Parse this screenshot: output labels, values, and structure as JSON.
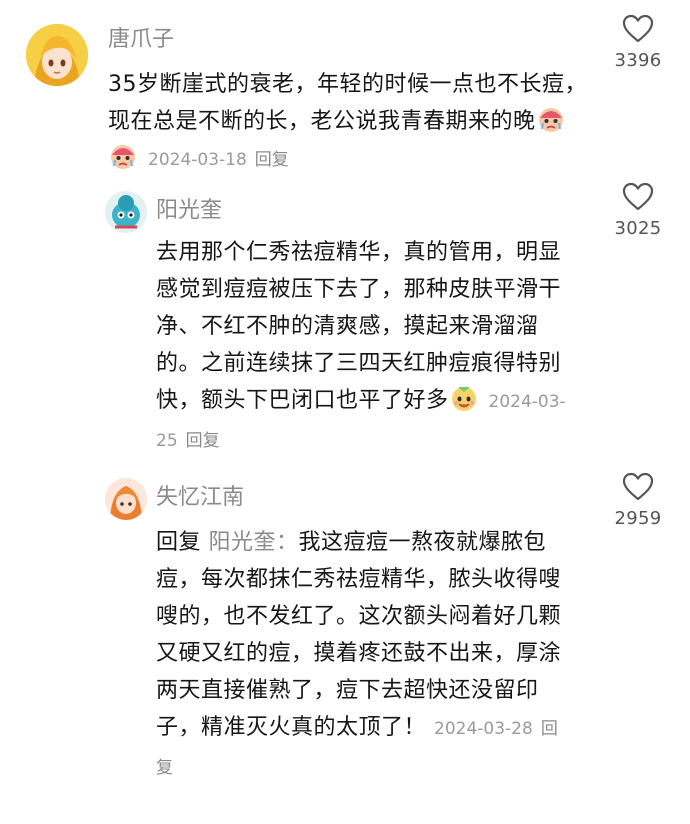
{
  "comments": [
    {
      "username": "唐爪子",
      "text": "35岁断崖式的衰老，年轻的时候一点也不长痘，现在总是不断的长，老公说我青春期来的晚",
      "date": "2024-03-18",
      "reply_label": "回复",
      "likes": "3396",
      "emoji": "crying-face-emoji"
    },
    {
      "username": "阳光奎",
      "text": "去用那个仁秀祛痘精华，真的管用，明显感觉到痘痘被压下去了，那种皮肤平滑干净、不红不肿的清爽感，摸起来滑溜溜的。之前连续抹了三四天红肿痘痕得特别快，额头下巴闭口也平了好多",
      "date": "2024-03-25",
      "reply_label": "回复",
      "likes": "3025",
      "emoji": "smiling-face-emoji"
    },
    {
      "username": "失忆江南",
      "reply_prefix": "回复",
      "reply_to": "阳光奎：",
      "text": "我这痘痘一熬夜就爆脓包痘，每次都抹仁秀祛痘精华，脓头收得嗖嗖的，也不发红了。这次额头闷着好几颗又硬又红的痘，摸着疼还鼓不出来，厚涂两天直接催熟了，痘下去超快还没留印子，精准灭火真的太顶了！",
      "date": "2024-03-28",
      "reply_label": "回复",
      "likes": "2959"
    }
  ]
}
